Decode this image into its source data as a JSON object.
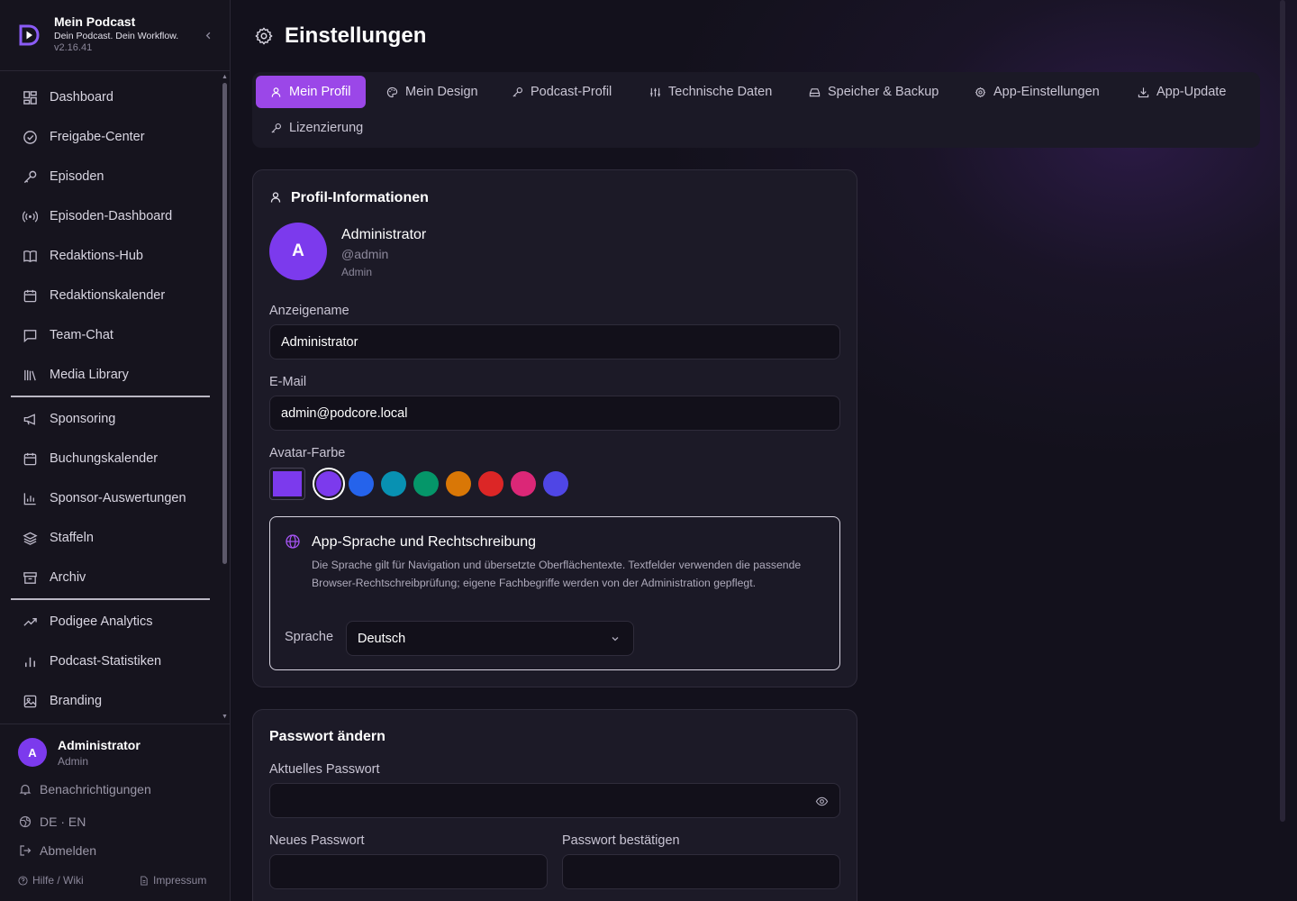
{
  "app": {
    "title": "Mein Podcast",
    "tagline": "Dein Podcast. Dein Workflow.",
    "version": "v2.16.41"
  },
  "sidebar": {
    "items": [
      {
        "label": "Dashboard"
      },
      {
        "label": "Freigabe-Center"
      },
      {
        "label": "Episoden"
      },
      {
        "label": "Episoden-Dashboard"
      },
      {
        "label": "Redaktions-Hub"
      },
      {
        "label": "Redaktionskalender"
      },
      {
        "label": "Team-Chat"
      },
      {
        "label": "Media Library"
      },
      {
        "label": "Sponsoring"
      },
      {
        "label": "Buchungskalender"
      },
      {
        "label": "Sponsor-Auswertungen"
      },
      {
        "label": "Staffeln"
      },
      {
        "label": "Archiv"
      },
      {
        "label": "Podigee Analytics"
      },
      {
        "label": "Podcast-Statistiken"
      },
      {
        "label": "Branding"
      }
    ],
    "user": {
      "initial": "A",
      "name": "Administrator",
      "role": "Admin"
    },
    "footer": {
      "notifications": "Benachrichtigungen",
      "language": "DE · EN",
      "logout": "Abmelden",
      "help": "Hilfe / Wiki",
      "imprint": "Impressum"
    }
  },
  "page": {
    "title": "Einstellungen"
  },
  "tabs": [
    {
      "label": "Mein Profil",
      "active": true
    },
    {
      "label": "Mein Design"
    },
    {
      "label": "Podcast-Profil"
    },
    {
      "label": "Technische Daten"
    },
    {
      "label": "Speicher & Backup"
    },
    {
      "label": "App-Einstellungen"
    },
    {
      "label": "App-Update"
    },
    {
      "label": "Lizenzierung"
    }
  ],
  "profile": {
    "section_title": "Profil-Informationen",
    "avatar_initial": "A",
    "name": "Administrator",
    "handle": "@admin",
    "role": "Admin",
    "display_name_label": "Anzeigename",
    "display_name_value": "Administrator",
    "email_label": "E-Mail",
    "email_value": "admin@podcore.local",
    "avatar_color_label": "Avatar-Farbe",
    "avatar_colors": [
      "#7c3aed",
      "#2563eb",
      "#0891b2",
      "#059669",
      "#d97706",
      "#dc2626",
      "#db2777",
      "#4f46e5"
    ],
    "selected_color": "#7c3aed"
  },
  "language_box": {
    "title": "App-Sprache und Rechtschreibung",
    "description": "Die Sprache gilt für Navigation und übersetzte Oberflächentexte. Textfelder verwenden die passende Browser-Rechtschreibprüfung; eigene Fachbegriffe werden von der Administration gepflegt.",
    "label": "Sprache",
    "value": "Deutsch"
  },
  "password": {
    "title": "Passwort ändern",
    "current_label": "Aktuelles Passwort",
    "new_label": "Neues Passwort",
    "confirm_label": "Passwort bestätigen"
  },
  "colors": {
    "accent": "#9b47e8",
    "avatar": "#7c3aed"
  }
}
